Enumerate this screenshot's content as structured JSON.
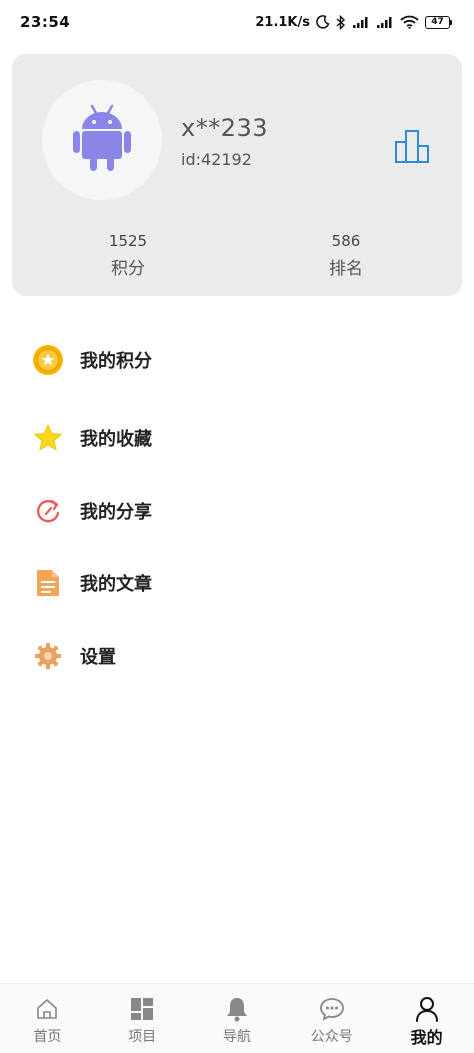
{
  "status_bar": {
    "time": "23:54",
    "network_speed": "21.1K/s",
    "battery": "47",
    "icons": [
      "moon-icon",
      "bluetooth-icon",
      "signal-icon",
      "signal-icon",
      "wifi-icon",
      "battery-icon"
    ]
  },
  "profile": {
    "username": "x**233",
    "user_id": "id:42192",
    "avatar_icon": "android-icon",
    "rank_icon": "bar-chart-icon",
    "stats": {
      "points_value": "1525",
      "points_label": "积分",
      "rank_value": "586",
      "rank_label": "排名"
    }
  },
  "menu": {
    "items": [
      {
        "label": "我的积分",
        "icon": "coin-star-icon"
      },
      {
        "label": "我的收藏",
        "icon": "star-icon"
      },
      {
        "label": "我的分享",
        "icon": "share-icon"
      },
      {
        "label": "我的文章",
        "icon": "document-icon"
      },
      {
        "label": "设置",
        "icon": "gear-icon"
      }
    ]
  },
  "bottom_nav": {
    "items": [
      {
        "label": "首页",
        "icon": "home-icon"
      },
      {
        "label": "项目",
        "icon": "grid-icon"
      },
      {
        "label": "导航",
        "icon": "bell-icon"
      },
      {
        "label": "公众号",
        "icon": "chat-icon"
      },
      {
        "label": "我的",
        "icon": "user-icon"
      }
    ],
    "active": "我的"
  },
  "colors": {
    "card_bg": "#ebebeb",
    "android_purple": "#8b85e8",
    "rank_blue": "#2f8bd6",
    "coin_gold": "#f7b500",
    "star_yellow": "#f9d820",
    "share_red": "#ea5b5b",
    "doc_orange": "#f3a455",
    "gear_orange": "#e9a05e"
  }
}
